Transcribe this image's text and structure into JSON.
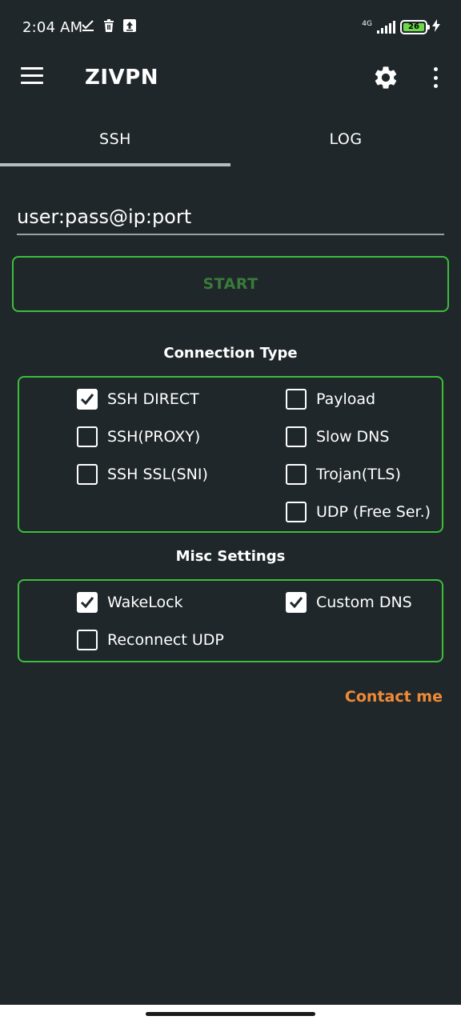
{
  "status_bar": {
    "time": "2:04 AM",
    "network": "4G",
    "battery_level": "26",
    "battery_color": "#6ed84b"
  },
  "toolbar": {
    "title": "ZIVPN",
    "menu_icon": "hamburger-menu-icon",
    "settings_icon": "gear-icon",
    "overflow_icon": "more-vert-icon"
  },
  "tabs": [
    {
      "label": "SSH",
      "selected": true
    },
    {
      "label": "LOG",
      "selected": false
    }
  ],
  "server_input": {
    "placeholder": "user:pass@ip:port",
    "value": ""
  },
  "start_button": {
    "label": "START",
    "border_color": "#3bbf3b",
    "text_color": "#3a7a3a"
  },
  "connection_type": {
    "title": "Connection Type",
    "options": [
      {
        "label": "SSH DIRECT",
        "checked": true
      },
      {
        "label": "SSH(PROXY)",
        "checked": false
      },
      {
        "label": "SSH SSL(SNI)",
        "checked": false
      },
      {
        "label": "Payload",
        "checked": false
      },
      {
        "label": "Slow DNS",
        "checked": false
      },
      {
        "label": "Trojan(TLS)",
        "checked": false
      },
      {
        "label": "UDP (Free Ser.)",
        "checked": false
      }
    ]
  },
  "misc_settings": {
    "title": "Misc Settings",
    "options": [
      {
        "label": "WakeLock",
        "checked": true
      },
      {
        "label": "Reconnect UDP",
        "checked": false
      },
      {
        "label": "Custom DNS",
        "checked": true
      }
    ]
  },
  "contact": {
    "label": "Contact me",
    "color": "#f08a36"
  },
  "colors": {
    "background": "#1f272b",
    "accent_green": "#3bbf3b",
    "tab_indicator": "#b8bcbf"
  }
}
